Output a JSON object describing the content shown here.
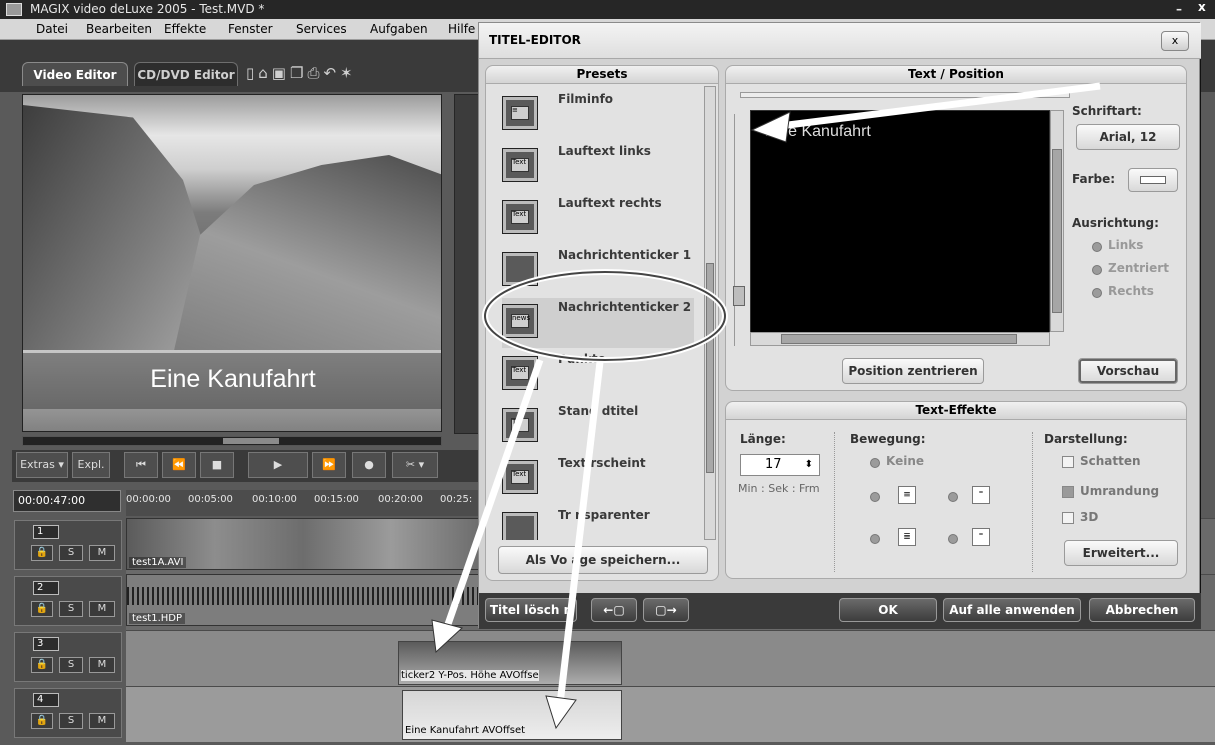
{
  "app": {
    "title": "MAGIX video deLuxe 2005 - Test.MVD *",
    "menu": [
      "Datei",
      "Bearbeiten",
      "Effekte",
      "Fenster",
      "Services",
      "Aufgaben",
      "Hilfe"
    ],
    "tabs": [
      "Video Editor",
      "CD/DVD Editor"
    ],
    "toolbar_icons": [
      "new-icon",
      "open-icon",
      "save-icon",
      "copy-icon",
      "print-icon",
      "undo-icon",
      "wizard-icon"
    ]
  },
  "preview": {
    "caption": "Eine Kanufahrt"
  },
  "transport": {
    "extras": "Extras ▾",
    "expl": "Expl.",
    "buttons": [
      "⏮",
      "⏪",
      "■",
      "▶",
      "⏩",
      "●",
      "✂ ▾"
    ]
  },
  "timeline": {
    "timecode": "00:00:47:00",
    "ruler": [
      "00:00:00",
      "00:05:00",
      "00:10:00",
      "00:15:00",
      "00:20:00",
      "00:25:"
    ],
    "tracks": [
      {
        "num": "1",
        "s": "S",
        "m": "M"
      },
      {
        "num": "2",
        "s": "S",
        "m": "M"
      },
      {
        "num": "3",
        "s": "S",
        "m": "M"
      },
      {
        "num": "4",
        "s": "S",
        "m": "M"
      }
    ],
    "clips": {
      "video": "test1A.AVI",
      "audio": "test1.HDP",
      "ticker": "ticker2  Y-Pos.  Höhe  AVOffse",
      "title": "Eine Kanufahrt  AVOffset"
    }
  },
  "dialog": {
    "title": "TITEL-EDITOR",
    "close": "x",
    "presets": {
      "header": "Presets",
      "items": [
        {
          "label": "Filminfo",
          "icon": "film-info-icon"
        },
        {
          "label": "Lauftext links",
          "icon": "scroll-left-icon"
        },
        {
          "label": "Lauftext rechts",
          "icon": "scroll-right-icon"
        },
        {
          "label": "Nachrichtenticker 1",
          "icon": "news-ticker-icon"
        },
        {
          "label": "Nachrichtenticker 2",
          "icon": "news-ticker-icon"
        },
        {
          "label": "Punkte",
          "icon": "dots-icon"
        },
        {
          "label": "Stand   dtitel",
          "icon": "standtitel-icon"
        },
        {
          "label": "Text   rscheint",
          "icon": "text-appears-icon"
        },
        {
          "label": "Tr   nsparenter",
          "icon": "transparent-icon"
        }
      ],
      "save_button": "Als Vo   age speichern..."
    },
    "text_position": {
      "header": "Text / Position",
      "text": "Eine Kanufahrt",
      "font_label": "Schriftart:",
      "font_value": "Arial, 12",
      "color_label": "Farbe:",
      "align_label": "Ausrichtung:",
      "align_options": [
        "Links",
        "Zentriert",
        "Rechts"
      ],
      "center_button": "Position zentrieren",
      "preview_button": "Vorschau"
    },
    "text_effects": {
      "header": "Text-Effekte",
      "length_label": "Länge:",
      "length_value": "17",
      "length_unit": "Min : Sek : Frm",
      "movement_label": "Bewegung:",
      "movement_none": "Keine",
      "display_label": "Darstellung:",
      "options": [
        {
          "label": "Schatten",
          "checked": false
        },
        {
          "label": "Umrandung",
          "checked": true
        },
        {
          "label": "3D",
          "checked": false
        }
      ],
      "advanced_button": "Erweitert..."
    },
    "footer": {
      "delete": "Titel lösch   n",
      "ok": "OK",
      "apply_all": "Auf alle anwenden",
      "cancel": "Abbrechen"
    }
  }
}
